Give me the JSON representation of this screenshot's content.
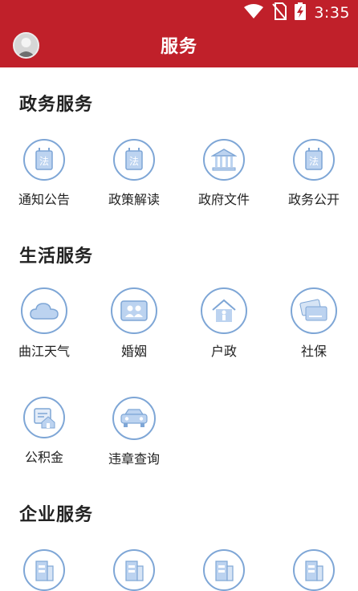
{
  "status_bar": {
    "time": "3:35",
    "icons": [
      "wifi-icon",
      "no-sim-icon",
      "battery-charging-icon"
    ]
  },
  "header": {
    "title": "服务",
    "avatar_icon": "user-avatar-icon"
  },
  "sections": [
    {
      "title": "政务服务",
      "items": [
        {
          "label": "通知公告",
          "icon": "law-book-icon"
        },
        {
          "label": "政策解读",
          "icon": "law-book-icon"
        },
        {
          "label": "政府文件",
          "icon": "government-building-icon"
        },
        {
          "label": "政务公开",
          "icon": "law-book-icon"
        }
      ]
    },
    {
      "title": "生活服务",
      "items": [
        {
          "label": "曲江天气",
          "icon": "cloud-icon"
        },
        {
          "label": "婚姻",
          "icon": "couple-photo-icon"
        },
        {
          "label": "户政",
          "icon": "house-person-icon"
        },
        {
          "label": "社保",
          "icon": "social-security-card-icon"
        },
        {
          "label": "公积金",
          "icon": "housing-fund-icon"
        },
        {
          "label": "违章查询",
          "icon": "car-icon"
        }
      ]
    },
    {
      "title": "企业服务",
      "items": [
        {
          "label": "",
          "icon": "enterprise-building-icon"
        },
        {
          "label": "",
          "icon": "enterprise-building-icon"
        },
        {
          "label": "",
          "icon": "enterprise-building-icon"
        },
        {
          "label": "",
          "icon": "enterprise-building-icon"
        }
      ]
    }
  ],
  "colors": {
    "header_bg": "#c0202a",
    "icon_stroke": "#7ea6d6",
    "icon_fill": "#bcd3f0",
    "text": "#222222"
  }
}
